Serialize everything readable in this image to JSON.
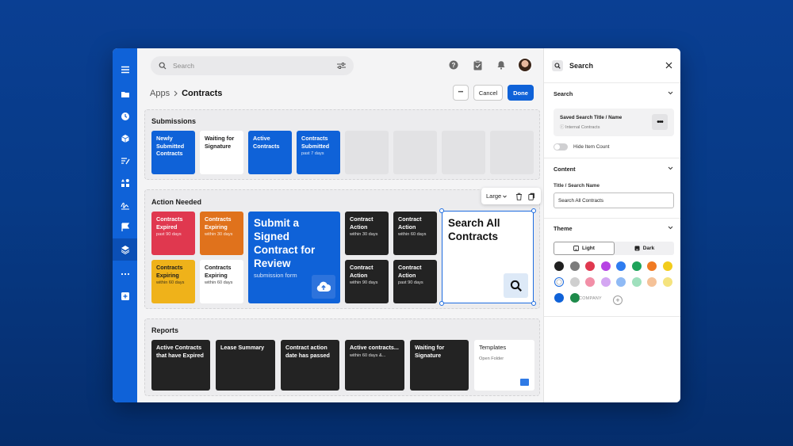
{
  "topbar": {
    "search_placeholder": "Search"
  },
  "breadcrumb": {
    "parent": "Apps",
    "current": "Contracts"
  },
  "header_buttons": {
    "more": "•••",
    "cancel": "Cancel",
    "done": "Done"
  },
  "submissions": {
    "title": "Submissions",
    "tiles": [
      {
        "label": "Newly Submitted Contracts",
        "sub": "",
        "color": "blue"
      },
      {
        "label": "Waiting for Signature",
        "sub": "",
        "color": "white"
      },
      {
        "label": "Active Contracts",
        "sub": "",
        "color": "blue"
      },
      {
        "label": "Contracts Submitted",
        "sub": "past 7 days",
        "color": "blue"
      }
    ]
  },
  "action_needed": {
    "title": "Action Needed",
    "small_tiles": [
      {
        "label": "Contracts Expired",
        "sub": "past 90 days"
      },
      {
        "label": "Contracts Expiring",
        "sub": "within 30 days"
      },
      {
        "label": "Contracts Expiring",
        "sub": "within 60 days"
      },
      {
        "label": "Contracts Expiring",
        "sub": "within 60 days"
      }
    ],
    "big_tile": {
      "label": "Submit a Signed Contract for Review",
      "sub": "submission form"
    },
    "dark_tiles": [
      {
        "label": "Contract Action",
        "sub": "within 30 days"
      },
      {
        "label": "Contract Action",
        "sub": "within 60 days"
      },
      {
        "label": "Contract Action",
        "sub": "within 90 days"
      },
      {
        "label": "Contract Action",
        "sub": "past 90 days"
      }
    ],
    "selected_tile": {
      "label": "Search All Contracts"
    },
    "floating_toolbar": {
      "size_label": "Large"
    }
  },
  "reports": {
    "title": "Reports",
    "tiles": [
      {
        "label": "Active Contracts that have Expired",
        "sub": ""
      },
      {
        "label": "Lease Summary",
        "sub": ""
      },
      {
        "label": "Contract action date has passed",
        "sub": ""
      },
      {
        "label": "Active contracts...",
        "sub": "within 60 days &..."
      },
      {
        "label": "Waiting for Signature",
        "sub": ""
      },
      {
        "label": "Templates",
        "sub": "Open Folder"
      }
    ]
  },
  "panel": {
    "title": "Search",
    "search_section": {
      "title": "Search",
      "saved_title": "Saved Search Title / Name",
      "saved_sub": "Internal Contracts",
      "hide_count_label": "Hide Item Count"
    },
    "content_section": {
      "title": "Content",
      "field_label": "Title / Search Name",
      "field_value": "Search All Contracts"
    },
    "theme_section": {
      "title": "Theme",
      "light_label": "Light",
      "dark_label": "Dark",
      "swatches_row1": [
        "#1f1f1f",
        "#7c7c7c",
        "#e0384f",
        "#b642e3",
        "#2e7cf0",
        "#1ea35a",
        "#f07a22",
        "#f2cc1c"
      ],
      "swatches_row2": [
        "#ffffff",
        "#cfcfcf",
        "#f28fa7",
        "#d4a6f2",
        "#8fbaf5",
        "#9fe0bd",
        "#f5c298",
        "#f5e37e"
      ],
      "swatches_row3": [
        "#0f62d8",
        "#1e8a4a"
      ],
      "company_label": "COMPANY",
      "add_label": "+"
    }
  },
  "colors": {
    "accent": "#0f62d8",
    "background": "#063a88",
    "tile_red": "#e0384f",
    "tile_orange": "#e0721c",
    "tile_yellow": "#efb21a",
    "tile_dark": "#232323"
  },
  "icons": {
    "rail": [
      "menu-icon",
      "folder-icon",
      "clock-icon",
      "cube-icon",
      "form-icon",
      "shapes-icon",
      "signature-icon",
      "flag-icon",
      "layers-icon",
      "more-icon",
      "add-widget-icon"
    ],
    "topbar": [
      "search-icon",
      "filter-icon",
      "help-icon",
      "tasks-icon",
      "bell-icon",
      "avatar"
    ]
  }
}
